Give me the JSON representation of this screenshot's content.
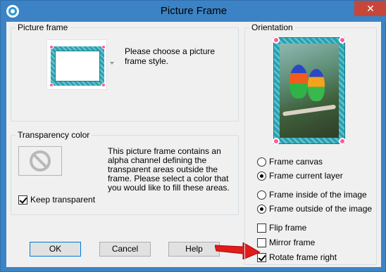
{
  "window": {
    "title": "Picture Frame",
    "close_label": "✕"
  },
  "picture_frame": {
    "legend": "Picture frame",
    "description": "Please choose a picture frame style."
  },
  "transparency": {
    "legend": "Transparency color",
    "description": "This picture frame contains an alpha channel defining the transparent areas outside the frame.  Please select a color that you would like to fill these areas.",
    "keep_transparent_label": "Keep transparent",
    "keep_transparent_checked": true
  },
  "buttons": {
    "ok": "OK",
    "cancel": "Cancel",
    "help": "Help"
  },
  "orientation": {
    "legend": "Orientation",
    "frame_canvas": "Frame canvas",
    "frame_current_layer": "Frame current layer",
    "frame_inside": "Frame inside of the image",
    "frame_outside": "Frame outside of the image",
    "flip_frame": "Flip frame",
    "mirror_frame": "Mirror frame",
    "rotate_frame_right": "Rotate frame right"
  },
  "colors": {
    "titlebar": "#3b83c4",
    "close": "#c7463a",
    "frame_teal": "#27a3b3",
    "arrow_red": "#e21b1b"
  }
}
